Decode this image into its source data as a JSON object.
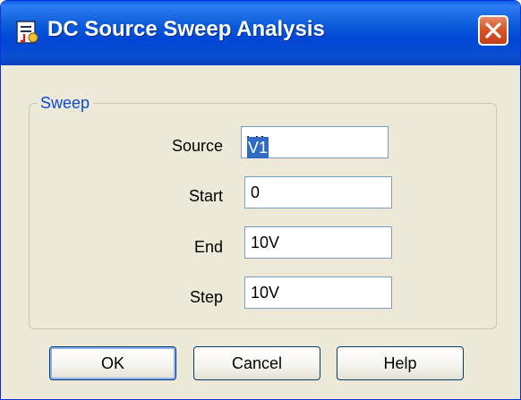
{
  "window": {
    "title": "DC Source Sweep Analysis",
    "icon": "app-icon"
  },
  "sweep": {
    "group_label": "Sweep",
    "fields": [
      {
        "label": "Source",
        "value": "V1"
      },
      {
        "label": "Start",
        "value": "0"
      },
      {
        "label": "End",
        "value": "10V"
      },
      {
        "label": "Step",
        "value": "10V"
      }
    ]
  },
  "buttons": {
    "ok": "OK",
    "cancel": "Cancel",
    "help": "Help"
  },
  "colors": {
    "titlebar": "#0046d5",
    "close": "#d9562a",
    "group_label": "#0b4ad1",
    "selection": "#316ac5"
  }
}
